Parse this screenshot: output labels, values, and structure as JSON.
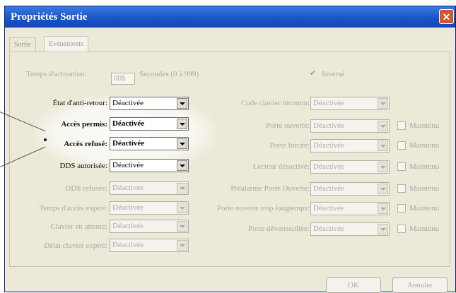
{
  "window": {
    "title": "Propriétés Sortie",
    "close_glyph": "✕"
  },
  "tabs": [
    {
      "label": "Sortie"
    },
    {
      "label": "Evénements"
    }
  ],
  "activation": {
    "label": "Temps d'activation:",
    "value": "005",
    "units": "Secondes (0 à 999)",
    "checkbox_mark": "✔",
    "checkbox_label": "Inversé"
  },
  "left_rows": [
    {
      "label": "État d'anti-retour:",
      "value": "Déactivée"
    },
    {
      "label": "Accès permis:",
      "value": "Déactivée"
    },
    {
      "label": "Accès refusé:",
      "value": "Déactivée"
    },
    {
      "label": "DDS autorisée:",
      "value": "Déactivée"
    },
    {
      "label": "DDS refusée:",
      "value": "Déactivée"
    },
    {
      "label": "Temps d'accès expiré:",
      "value": "Déactivée"
    },
    {
      "label": "Clavier en attente:",
      "value": "Déactivée"
    },
    {
      "label": "Délai clavier expiré:",
      "value": "Déactivée"
    }
  ],
  "right_rows": [
    {
      "label": "Code clavier inconnu:",
      "value": "Déactivée"
    },
    {
      "label": "Porte ouverte:",
      "value": "Déactivée",
      "maintenu": "Maintenu"
    },
    {
      "label": "Porte forcée:",
      "value": "Déactivée",
      "maintenu": "Maintenu"
    },
    {
      "label": "Lecteur désactivé:",
      "value": "Déactivée",
      "maintenu": "Maintenu"
    },
    {
      "label": "Préalarme Porte Ouverte:",
      "value": "Déactivée",
      "maintenu": "Maintenu"
    },
    {
      "label": "Porte ouverte trop longtemps:",
      "value": "Déactivée",
      "maintenu": "Maintenu"
    },
    {
      "label": "Porte déverrouillée:",
      "value": "Déactivée",
      "maintenu": "Maintenu"
    }
  ],
  "buttons": {
    "ok": "OK",
    "cancel": "Annuler"
  }
}
